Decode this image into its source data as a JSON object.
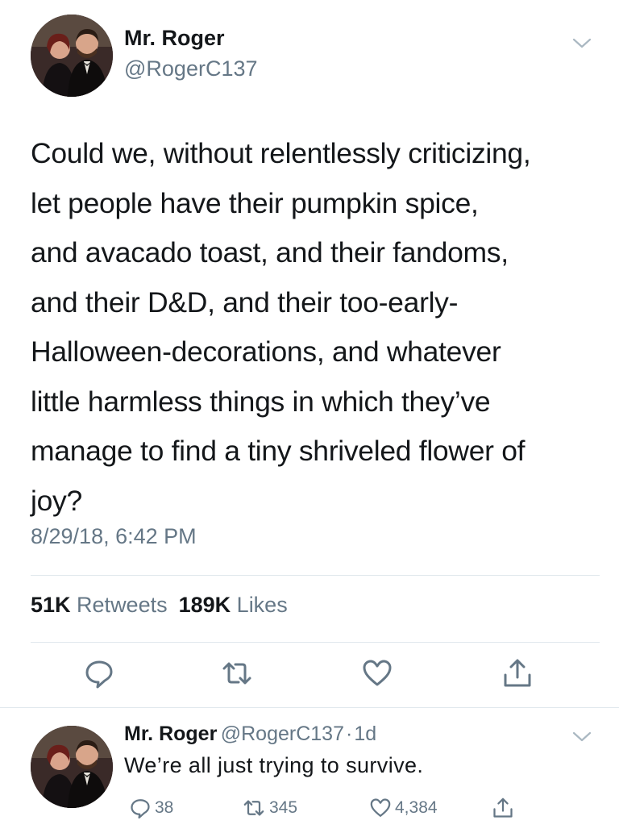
{
  "tweet": {
    "author_name": "Mr. Roger",
    "author_handle": "@RogerC137",
    "text_lines": [
      "Could we, without relentlessly criticizing,",
      "let people have their pumpkin spice,",
      "and avacado toast, and their fandoms,",
      "and their D&D, and their too-early-",
      "Halloween-decorations, and whatever",
      "little harmless things in which they’ve",
      "manage to find a tiny shriveled flower of",
      "joy?"
    ],
    "timestamp": "8/29/18, 6:42 PM",
    "retweets_count": "51K",
    "retweets_label": "Retweets",
    "likes_count": "189K",
    "likes_label": "Likes"
  },
  "reply": {
    "author_name": "Mr. Roger",
    "author_handle": "@RogerC137",
    "separator": "·",
    "age": "1d",
    "text": "We’re all just trying to survive.",
    "replies_count": "38",
    "retweets_count": "345",
    "likes_count": "4,384"
  },
  "icons": {
    "more": "chevron-down-icon",
    "reply": "speech-bubble-icon",
    "retweet": "retweet-icon",
    "like": "heart-icon",
    "share": "share-icon"
  },
  "colors": {
    "text": "#14171a",
    "secondary": "#657786",
    "divider": "#e1e8ed"
  }
}
